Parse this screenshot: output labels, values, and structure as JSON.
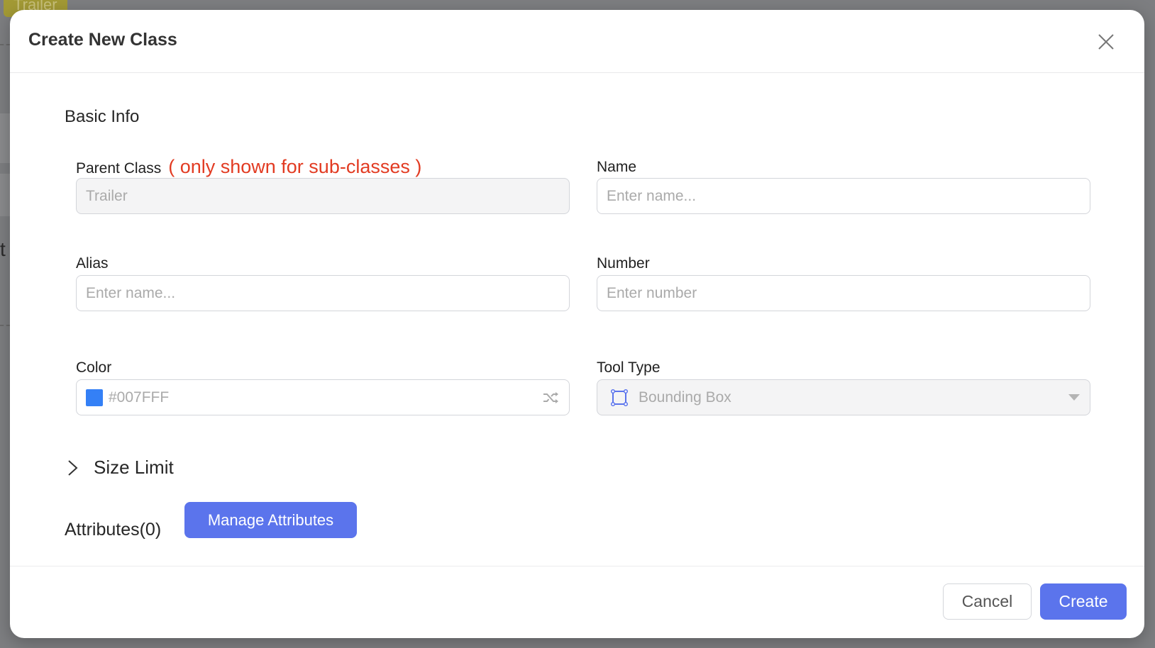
{
  "background": {
    "tag_label": "Trailer",
    "partial_text": "t"
  },
  "dialog": {
    "title": "Create New Class",
    "close_icon": "close-icon",
    "section_title": "Basic Info",
    "fields": {
      "parent_class": {
        "label": "Parent Class",
        "hint": "( only shown for sub-classes )",
        "value": "Trailer",
        "disabled": true
      },
      "name": {
        "label": "Name",
        "placeholder": "Enter name..."
      },
      "alias": {
        "label": "Alias",
        "placeholder": "Enter name..."
      },
      "number": {
        "label": "Number",
        "placeholder": "Enter number"
      },
      "color": {
        "label": "Color",
        "value": "#007FFF",
        "swatch_color": "#3480f6",
        "randomize_icon": "shuffle-icon"
      },
      "tool_type": {
        "label": "Tool Type",
        "selected": "Bounding Box",
        "icon": "bounding-box-icon",
        "disabled": true
      }
    },
    "size_limit": {
      "label": "Size Limit",
      "expanded": false
    },
    "attributes": {
      "label": "Attributes(0)",
      "count": 0,
      "manage_button": "Manage Attributes"
    },
    "footer": {
      "cancel": "Cancel",
      "create": "Create"
    }
  },
  "colors": {
    "primary": "#5b74ec",
    "hint_red": "#e23b22",
    "swatch": "#3480f6"
  }
}
